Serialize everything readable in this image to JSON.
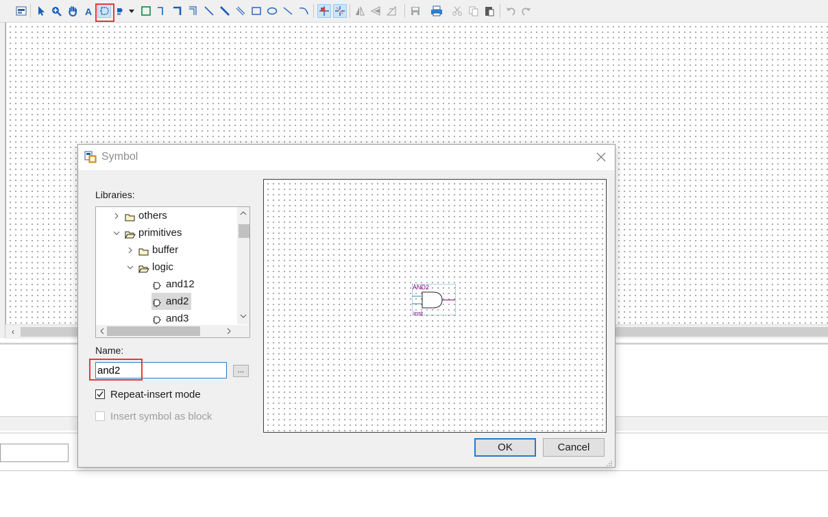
{
  "dialog": {
    "title": "Symbol",
    "libraries_label": "Libraries:",
    "tree": [
      {
        "label": "others",
        "expanded": false,
        "type": "folder",
        "level": 1
      },
      {
        "label": "primitives",
        "expanded": true,
        "type": "folder",
        "level": 1
      },
      {
        "label": "buffer",
        "expanded": false,
        "type": "folder",
        "level": 2
      },
      {
        "label": "logic",
        "expanded": true,
        "type": "folder",
        "level": 2
      },
      {
        "label": "and12",
        "type": "symbol",
        "level": 3
      },
      {
        "label": "and2",
        "type": "symbol",
        "level": 3,
        "selected": true
      },
      {
        "label": "and3",
        "type": "symbol",
        "level": 3
      }
    ],
    "name_label": "Name:",
    "name_value": "and2",
    "browse_label": "...",
    "repeat_insert_label": "Repeat-insert mode",
    "repeat_insert_checked": true,
    "insert_block_label": "Insert symbol as block",
    "insert_block_checked": false,
    "insert_block_enabled": false,
    "preview": {
      "symbol_name": "AND2",
      "instance_name": "inst"
    },
    "ok_label": "OK",
    "cancel_label": "Cancel"
  },
  "toolbar": {
    "icons": [
      "block-insert-icon",
      "selection-tool-icon",
      "zoom-tool-icon",
      "hand-tool-icon",
      "text-tool-icon",
      "symbol-tool-icon",
      "pin-tool-icon",
      "dropdown-arrow-icon",
      "block-tool-icon",
      "orthogonal-node-icon",
      "orthogonal-bus-icon",
      "orthogonal-conduit-icon",
      "diagonal-node-icon",
      "diagonal-bus-icon",
      "diagonal-conduit-icon",
      "rectangle-icon",
      "oval-icon",
      "line-icon",
      "arc-icon",
      "rubberbanding-icon",
      "partial-line-select-icon",
      "flip-horizontal-icon",
      "flip-vertical-icon",
      "rotate-icon",
      "save-icon",
      "print-icon",
      "cut-icon",
      "copy-icon",
      "paste-icon",
      "undo-icon",
      "redo-icon"
    ],
    "highlighted": "symbol-tool-icon"
  },
  "colors": {
    "accent": "#2b78c2",
    "highlight": "#e53935",
    "gate_purple": "#800080"
  }
}
